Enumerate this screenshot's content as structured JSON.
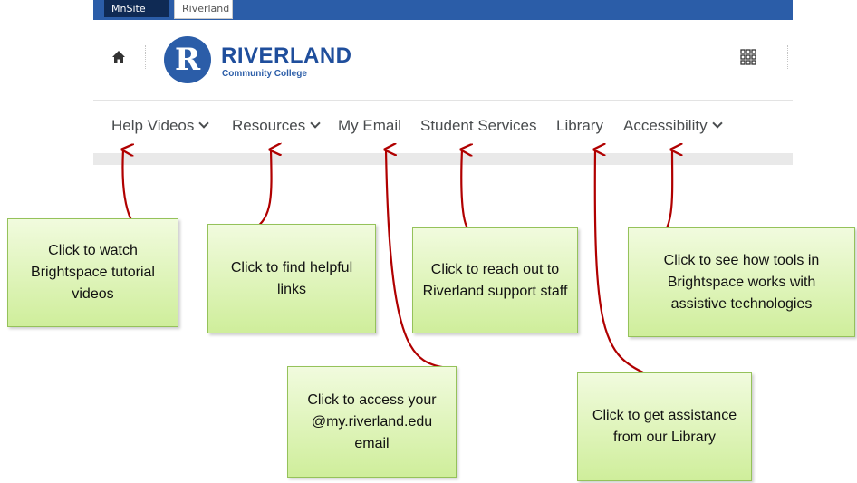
{
  "site_tabs": {
    "mnsite": "MnSite",
    "riverland": "Riverland"
  },
  "logo": {
    "mark": "R",
    "name": "RIVERLAND",
    "subtitle": "Community College"
  },
  "icons": {
    "home": "home-icon",
    "waffle": "grid-icon",
    "dropdown": "chevron-down-icon"
  },
  "nav": {
    "help_videos": "Help Videos",
    "resources": "Resources",
    "my_email": "My Email",
    "student_services": "Student Services",
    "library": "Library",
    "accessibility": "Accessibility"
  },
  "callouts": {
    "help_videos": "Click to watch Brightspace tutorial videos",
    "resources": "Click to find helpful links",
    "student_services": "Click to reach out to Riverland support staff",
    "accessibility": "Click to see how tools in Brightspace works with assistive technologies",
    "my_email": "Click to access your @my.riverland.edu email",
    "library": "Click to get assistance from our Library"
  },
  "colors": {
    "brand_blue": "#2b5da8",
    "arrow_red": "#b00000",
    "callout_green": "#cfee9b"
  }
}
